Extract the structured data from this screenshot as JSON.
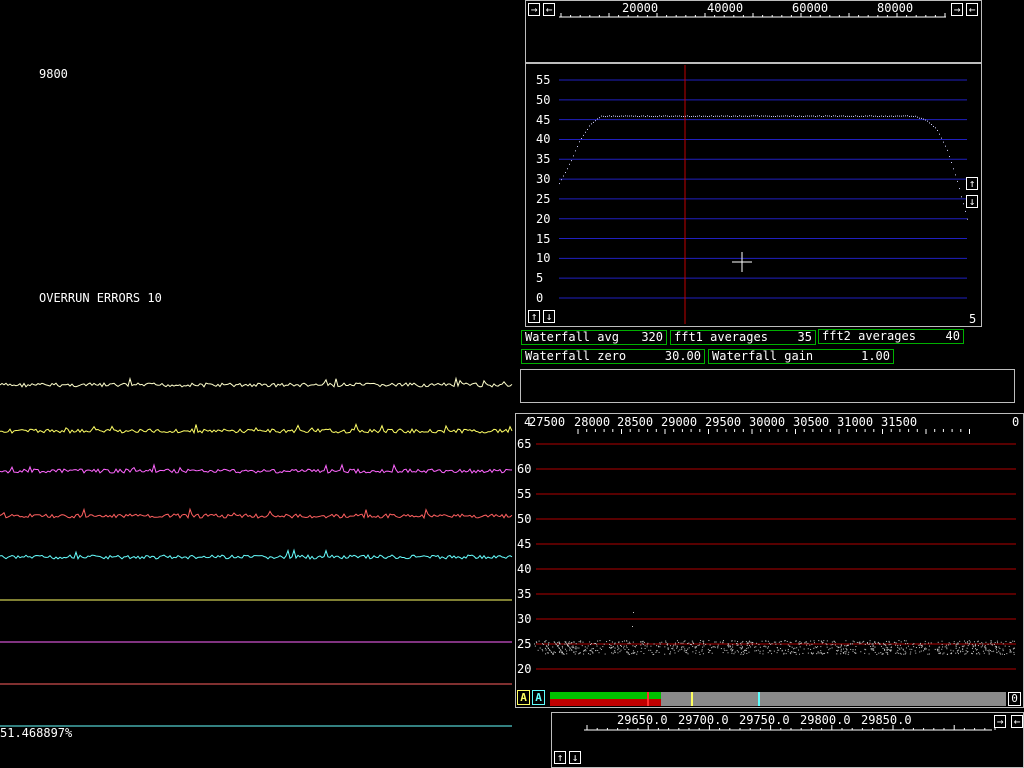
{
  "left": {
    "sample_rate": "9800",
    "overrun": "OVERRUN ERRORS 10",
    "percent": "51.468897%",
    "trace_colors": [
      "#ffffcc",
      "#ffff66",
      "#ff66ff",
      "#ff6060",
      "#66ffff"
    ],
    "flat_line_colors": [
      "#ffff66",
      "#ff66ff",
      "#ff6060",
      "#66ffff"
    ]
  },
  "top_scale": {
    "labels": [
      "20000",
      "40000",
      "60000",
      "80000"
    ],
    "left_buttons": [
      "→",
      "←"
    ],
    "right_buttons": [
      "→",
      "←"
    ]
  },
  "spectrum1": {
    "y_labels": [
      "55",
      "50",
      "45",
      "40",
      "35",
      "30",
      "25",
      "20",
      "15",
      "10",
      "5",
      "0"
    ],
    "corner_value": "5",
    "buttons_left": [
      "↑",
      "↓"
    ],
    "buttons_right": [
      "↑",
      "↓"
    ],
    "grid_color": "#2020c0",
    "marker_color": "#c00000"
  },
  "params": {
    "waterfall_avg": {
      "label": "Waterfall avg",
      "value": "320"
    },
    "fft1_avg": {
      "label": "fft1 averages",
      "value": "35"
    },
    "fft2_avg": {
      "label": "fft2 averages",
      "value": "40"
    },
    "waterfall_zero": {
      "label": "Waterfall zero",
      "value": "30.00"
    },
    "waterfall_gain": {
      "label": "Waterfall gain",
      "value": "1.00"
    }
  },
  "spectrum2": {
    "left_corner": "4",
    "right_corner": "0",
    "x_labels": [
      "27500",
      "28000",
      "28500",
      "29000",
      "29500",
      "30000",
      "30500",
      "31000",
      "31500"
    ],
    "y_labels": [
      "65",
      "60",
      "55",
      "50",
      "45",
      "40",
      "35",
      "30",
      "25",
      "20"
    ],
    "grid_color": "#b00000",
    "tags": [
      "A",
      "A"
    ],
    "bar_right": "0"
  },
  "bottom_scale": {
    "labels": [
      "29650.0",
      "29700.0",
      "29750.0",
      "29800.0",
      "29850.0"
    ],
    "buttons_right": [
      "→",
      "←"
    ],
    "buttons_left": [
      "↑",
      "↓"
    ]
  },
  "chart_data": {
    "type": "line",
    "series": [
      {
        "values": [
          29,
          34,
          40,
          44,
          46,
          46,
          46,
          46,
          46,
          46,
          46,
          46,
          46,
          46,
          46,
          46,
          46,
          46,
          46,
          46,
          46,
          46,
          46,
          46,
          46,
          46,
          46,
          46,
          46,
          46,
          46,
          46,
          46,
          46,
          46,
          45,
          43,
          38,
          30,
          20
        ]
      }
    ],
    "ylim": [
      0,
      55
    ],
    "y_ticks": [
      55,
      50,
      45,
      40,
      35,
      30,
      25,
      20,
      15,
      10,
      5,
      0
    ],
    "x_ticks": [
      20000,
      40000,
      60000,
      80000
    ],
    "grid": true
  }
}
